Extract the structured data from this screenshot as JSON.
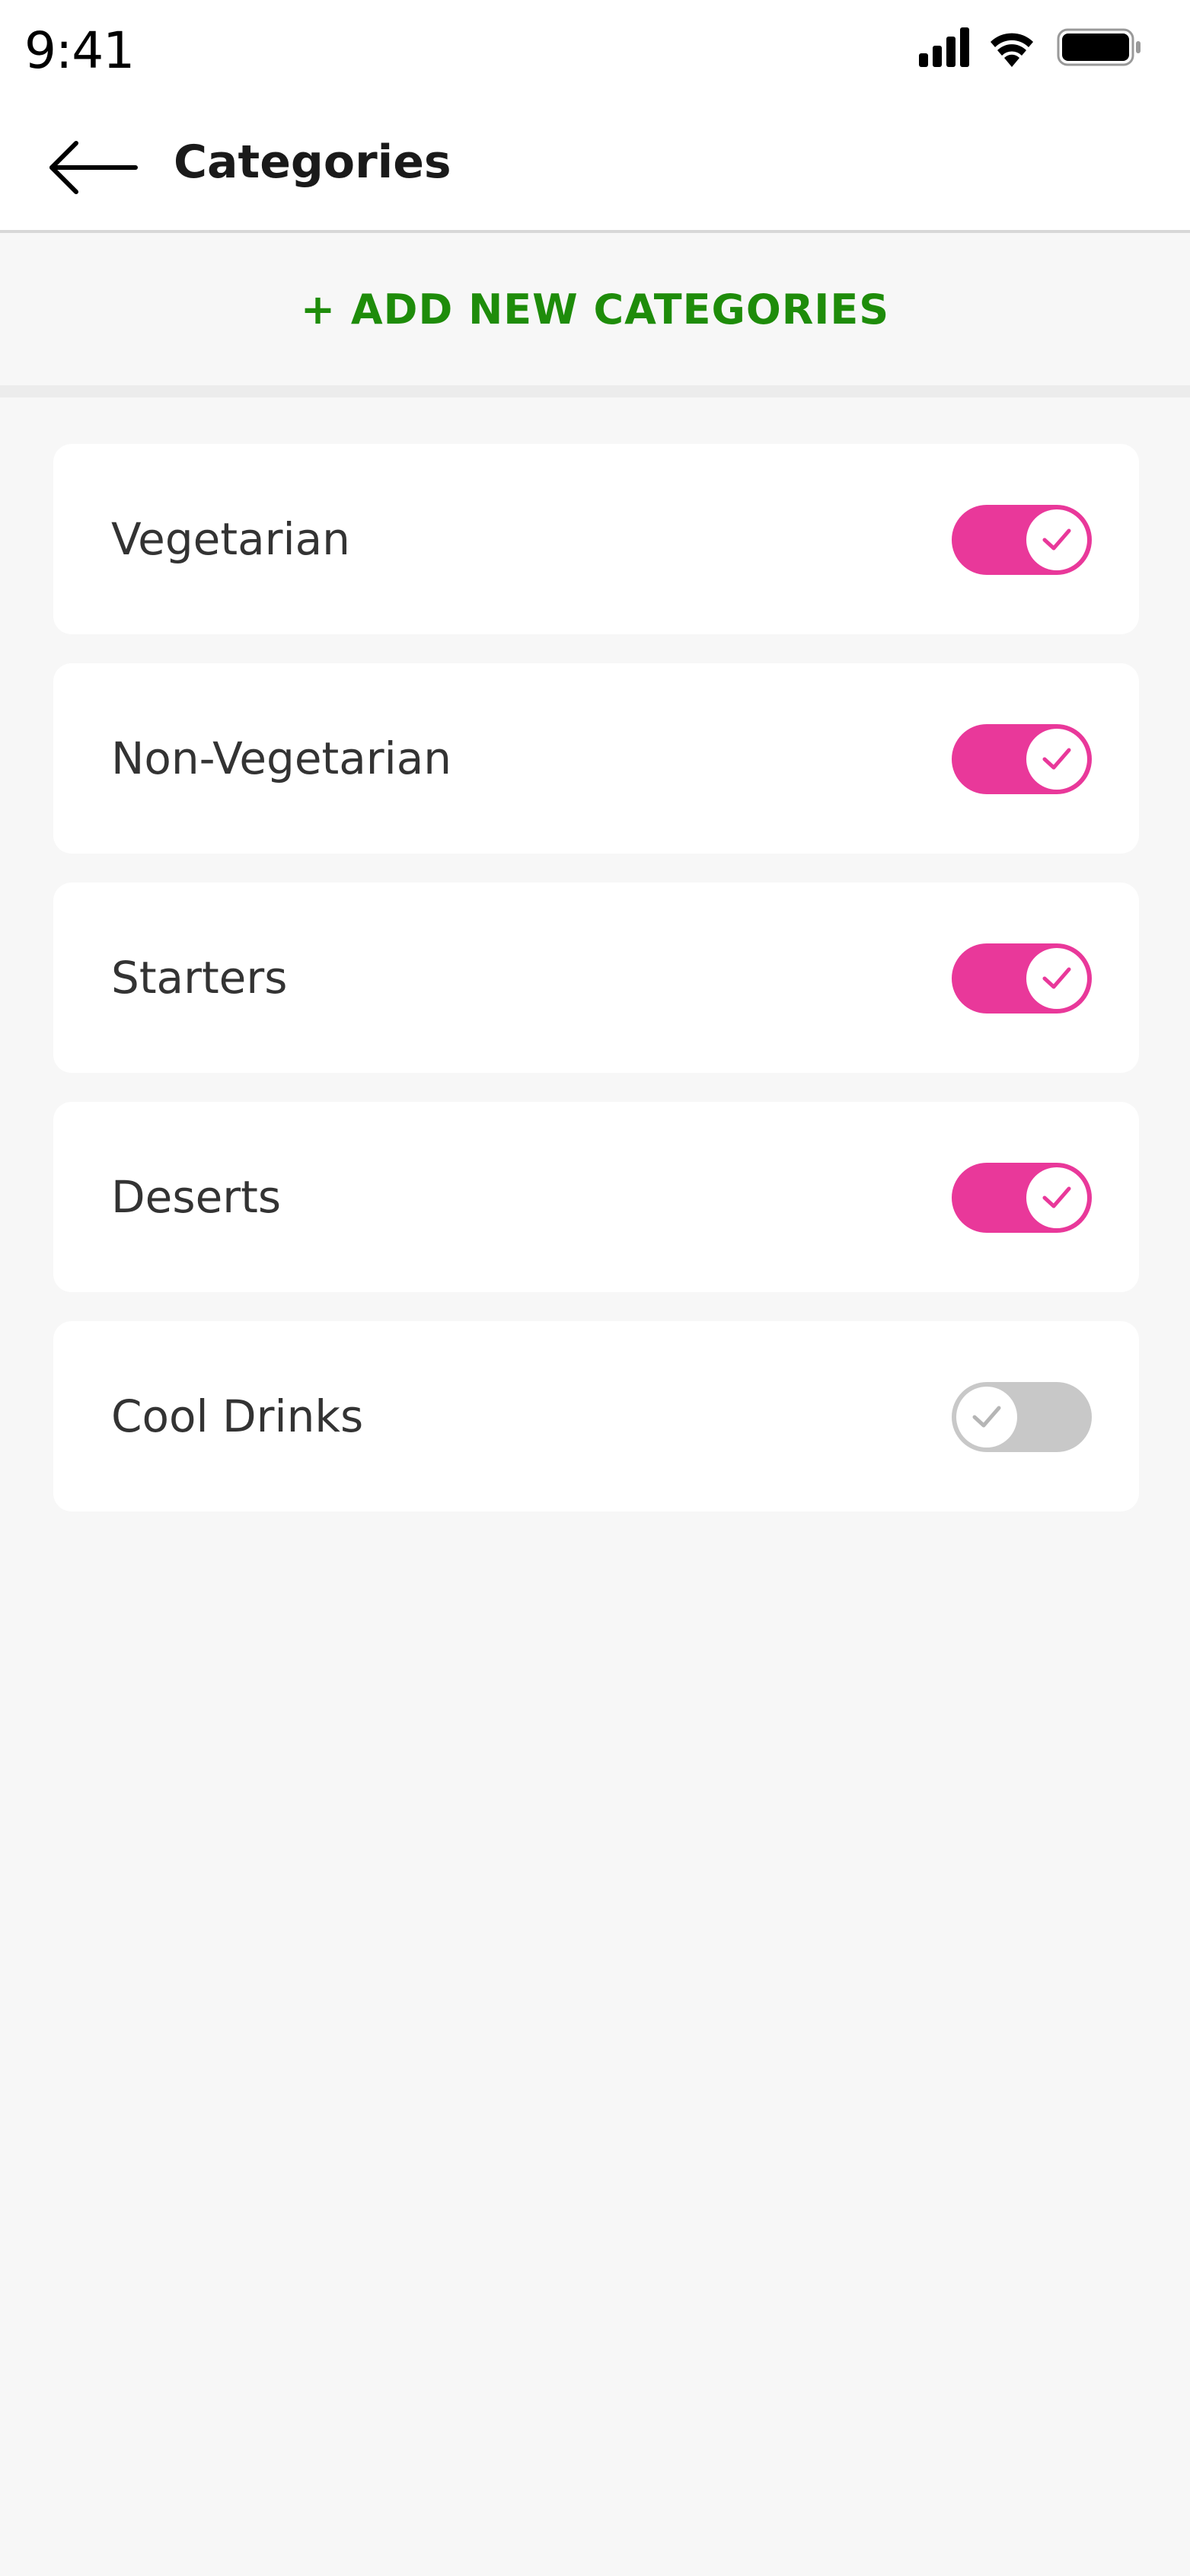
{
  "status": {
    "time": "9:41",
    "icons": [
      "signal-icon",
      "wifi-icon",
      "battery-icon"
    ]
  },
  "header": {
    "back_icon": "arrow-left-icon",
    "title": "Categories"
  },
  "add_button": {
    "label": "+ ADD NEW CATEGORIES",
    "color": "#1e8c0a"
  },
  "colors": {
    "toggle_on": "#e9389a",
    "toggle_off": "#c8c8c8",
    "background": "#f7f7f7"
  },
  "categories": [
    {
      "label": "Vegetarian",
      "enabled": true
    },
    {
      "label": "Non-Vegetarian",
      "enabled": true
    },
    {
      "label": "Starters",
      "enabled": true
    },
    {
      "label": "Deserts",
      "enabled": true
    },
    {
      "label": "Cool Drinks",
      "enabled": false
    }
  ]
}
